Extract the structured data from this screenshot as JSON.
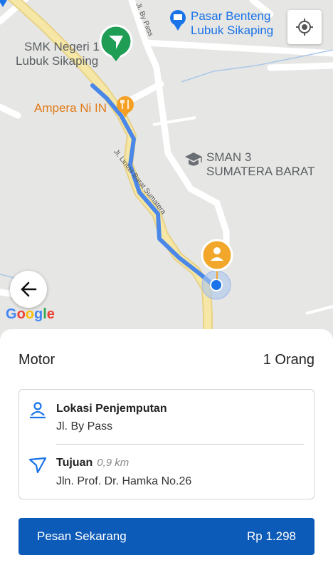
{
  "map": {
    "pois": {
      "school_1": "SMK Negeri 1",
      "school_1_line2": "Lubuk Sikaping",
      "restaurant": "Ampera Ni IN",
      "shop_line1": "Pasar Benteng",
      "shop_line2": "Lubuk Sikaping",
      "school_2_line1": "SMAN 3",
      "school_2_line2": "SUMATERA BARAT"
    },
    "roads": {
      "by_pass": "Jl. By Pass",
      "lintas_barat": "Jl. Lintas Barat Sumatera"
    },
    "google_logo": "Google",
    "route_color": "#4a87e8",
    "road_color": "#f6e7a6"
  },
  "booking": {
    "vehicle": "Motor",
    "passengers": "1 Orang",
    "pickup_title": "Lokasi Penjemputan",
    "pickup_address": "Jl. By Pass",
    "destination_title": "Tujuan",
    "destination_distance": "0,9 km",
    "destination_address": "Jln. Prof. Dr. Hamka No.26",
    "order_label": "Pesan Sekarang",
    "price": "Rp 1.298",
    "accent_color": "#0d5bb8"
  },
  "icons": {
    "back": "arrow-left-icon",
    "locate": "my-location-icon",
    "pickup": "person-pin-icon",
    "destination": "navigation-icon"
  }
}
